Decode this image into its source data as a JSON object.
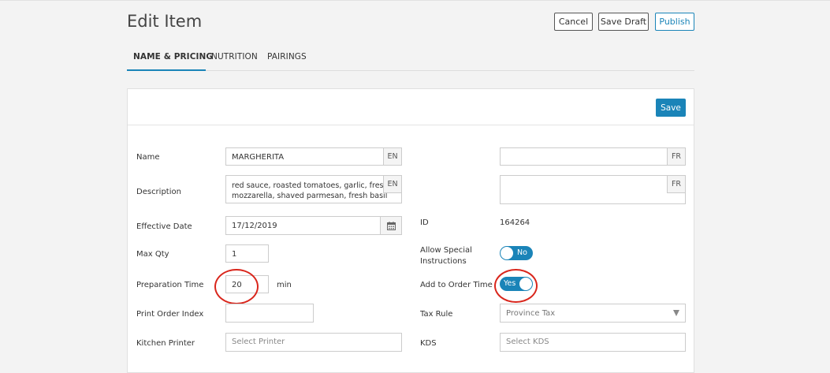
{
  "page": {
    "title": "Edit Item"
  },
  "header": {
    "cancel_label": "Cancel",
    "save_draft_label": "Save Draft",
    "publish_label": "Publish"
  },
  "tabs": [
    {
      "label": "NAME & PRICING",
      "active": true
    },
    {
      "label": "NUTRITION",
      "active": false
    },
    {
      "label": "PAIRINGS",
      "active": false
    }
  ],
  "card": {
    "save_label": "Save"
  },
  "form": {
    "name": {
      "label": "Name",
      "value": "MARGHERITA",
      "lang": "EN",
      "fr_value": "",
      "fr_lang": "FR"
    },
    "description": {
      "label": "Description",
      "line1": "red sauce, roasted tomatoes, garlic, fresh",
      "line2": "mozzarella, shaved parmesan, fresh basil",
      "lang": "EN",
      "fr_value": "",
      "fr_lang": "FR"
    },
    "effective_date": {
      "label": "Effective Date",
      "value": "17/12/2019",
      "icon": "calendar-icon"
    },
    "max_qty": {
      "label": "Max Qty",
      "value": "1"
    },
    "preparation_time": {
      "label": "Preparation Time",
      "value": "20",
      "unit": "min"
    },
    "print_order_index": {
      "label": "Print Order Index",
      "value": ""
    },
    "kitchen_printer": {
      "label": "Kitchen Printer",
      "placeholder": "Select Printer"
    },
    "id": {
      "label": "ID",
      "value": "164264"
    },
    "allow_special_instructions": {
      "label_line1": "Allow Special",
      "label_line2": "Instructions",
      "state": "No",
      "on": false
    },
    "add_to_order_time": {
      "label": "Add to Order Time",
      "state": "Yes",
      "on": true
    },
    "tax_rule": {
      "label": "Tax Rule",
      "selected": "Province Tax"
    },
    "kds": {
      "label": "KDS",
      "placeholder": "Select KDS"
    }
  },
  "colors": {
    "accent": "#1a84b8",
    "annotation": "#d9261c"
  }
}
